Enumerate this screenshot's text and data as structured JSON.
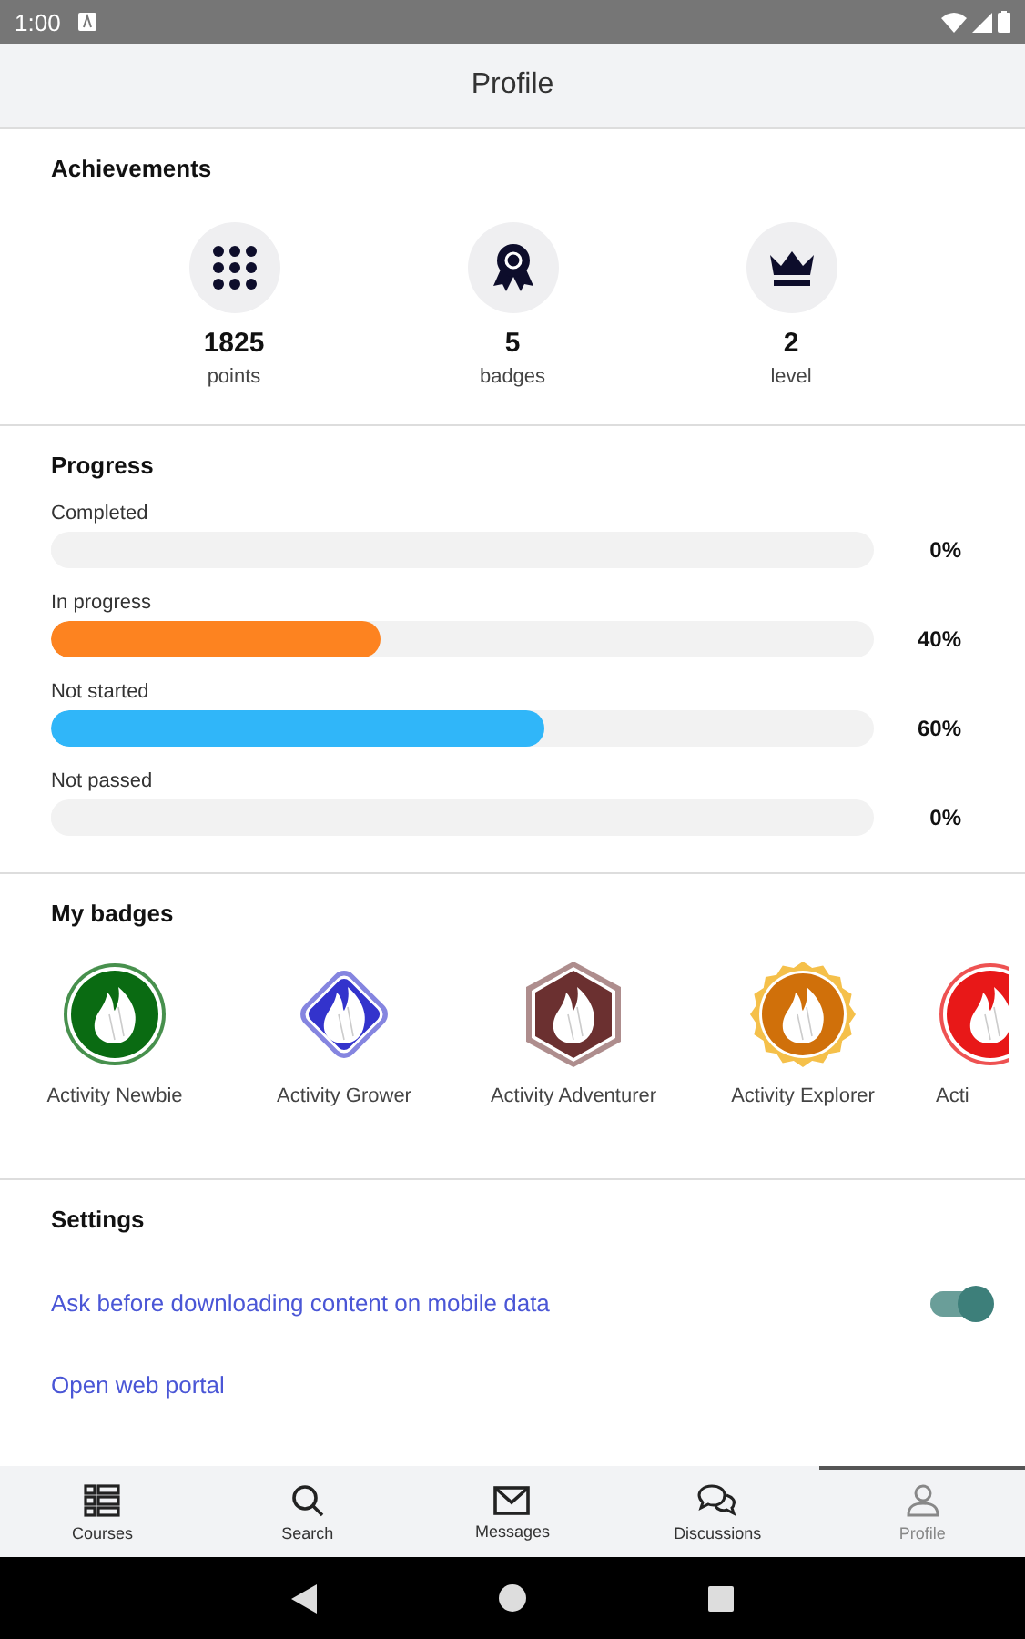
{
  "status_bar": {
    "time": "1:00"
  },
  "header": {
    "title": "Profile"
  },
  "achievements": {
    "title": "Achievements",
    "items": [
      {
        "kind": "points",
        "value": "1825",
        "label": "points"
      },
      {
        "kind": "badges",
        "value": "5",
        "label": "badges"
      },
      {
        "kind": "level",
        "value": "2",
        "label": "level"
      }
    ]
  },
  "progress": {
    "title": "Progress",
    "rows": [
      {
        "label": "Completed",
        "level": 0,
        "reading": "0%"
      },
      {
        "label": "In progress",
        "level": 0.4,
        "reading": "40%",
        "color": "#fd8320"
      },
      {
        "label": "Not started",
        "level": 0.6,
        "reading": "60%",
        "color": "#30b6f9"
      },
      {
        "label": "Not passed",
        "level": 0,
        "reading": "0%"
      }
    ]
  },
  "badges": {
    "title": "My badges",
    "items": [
      {
        "kind": "circle",
        "label": "Activity Newbie",
        "color": "#0a6b12"
      },
      {
        "kind": "diamond",
        "label": "Activity Grower",
        "color": "#3333cc"
      },
      {
        "kind": "hexagon",
        "label": "Activity Adventurer",
        "color": "#6b3030"
      },
      {
        "kind": "seal",
        "label": "Activity Explorer",
        "color": "#d0700a"
      },
      {
        "kind": "circle",
        "label": "Acti",
        "color": "#e81818"
      }
    ]
  },
  "settings": {
    "title": "Settings",
    "items": [
      {
        "kind": "toggle",
        "label": "Ask before downloading content on mobile data",
        "on": true
      },
      {
        "kind": "link",
        "label": "Open web portal"
      }
    ]
  },
  "tabs": [
    {
      "kind": "courses",
      "label": "Courses",
      "selected": false
    },
    {
      "kind": "search",
      "label": "Search",
      "selected": false
    },
    {
      "kind": "messages",
      "label": "Messages",
      "selected": false
    },
    {
      "kind": "discussions",
      "label": "Discussions",
      "selected": false
    },
    {
      "kind": "profile",
      "label": "Profile",
      "selected": true
    }
  ]
}
